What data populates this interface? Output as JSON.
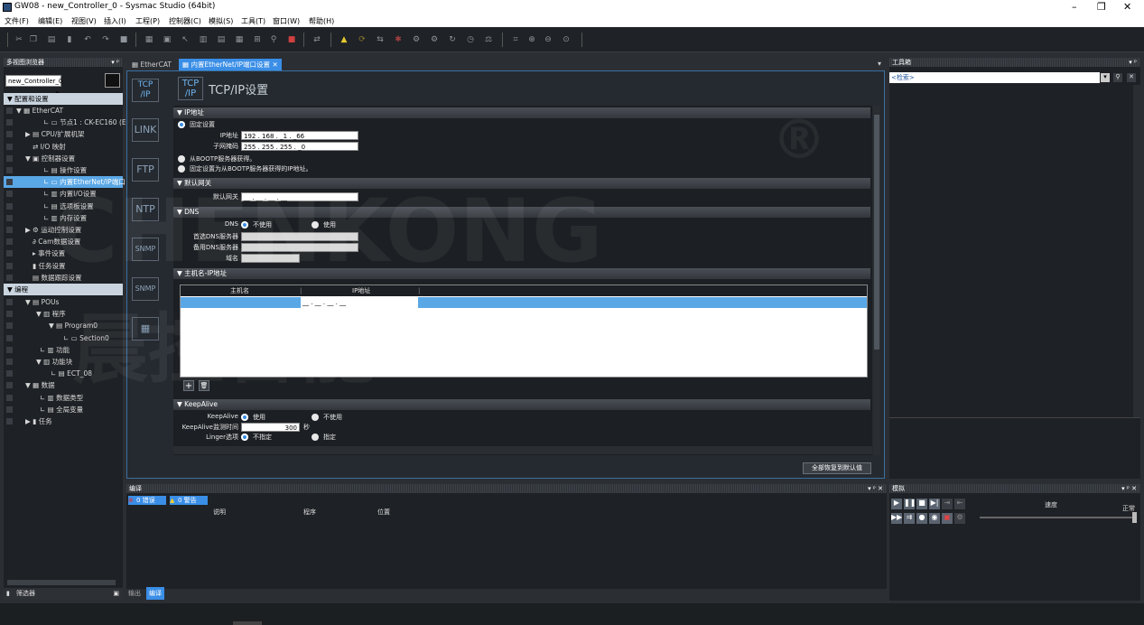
{
  "window": {
    "title": "GW08 - new_Controller_0 - Sysmac Studio (64bit)"
  },
  "menu": [
    "文件(F)",
    "编辑(E)",
    "视图(V)",
    "插入(I)",
    "工程(P)",
    "控制器(C)",
    "模拟(S)",
    "工具(T)",
    "窗口(W)",
    "帮助(H)"
  ],
  "left_panel": {
    "title": "多视图浏览器",
    "controller_select": "new_Controller_0",
    "section_config": "配置和设置",
    "tree_config": [
      "EtherCAT",
      "节点1 : CK-EC160 (E",
      "CPU/扩展机架",
      "I/O 映射",
      "控制器设置",
      "操作设置",
      "内置EtherNet/IP端口",
      "内置I/O设置",
      "选项板设置",
      "内存设置",
      "运动控制设置",
      "Cam数据设置",
      "事件设置",
      "任务设置",
      "数据跟踪设置"
    ],
    "section_program": "编程",
    "tree_program": [
      "POUs",
      "程序",
      "Program0",
      "Section0",
      "功能",
      "功能块",
      "ECT_08",
      "数据",
      "数据类型",
      "全局变量",
      "任务"
    ],
    "filter_label": "筛选器"
  },
  "tabs": [
    {
      "label": "EtherCAT"
    },
    {
      "label": "内置EtherNet/IP端口设置"
    }
  ],
  "editor": {
    "title": "TCP/IP设置",
    "side_icons": [
      "TCP/IP",
      "LINK",
      "FTP",
      "NTP",
      "SNMP",
      "SNMP",
      ""
    ],
    "sec_ip": "IP地址",
    "fixed_setting": "固定设置",
    "ip_label": "IP地址",
    "ip_value": "192 . 168 . _1 . _66",
    "mask_label": "子网掩码",
    "mask_value": "255 . 255 . 255 . _0",
    "bootp_opt": "从BOOTP服务器获得。",
    "bootp_fixed_opt": "固定设置为从BOOTP服务器获得的IP地址。",
    "sec_gateway": "默认网关",
    "gateway_label": "默认网关",
    "gateway_value": "__ . __ . __ . __",
    "sec_dns": "DNS",
    "dns_label": "DNS",
    "dns_off": "不使用",
    "dns_on": "使用",
    "primary_dns": "首选DNS服务器",
    "secondary_dns": "备用DNS服务器",
    "domain": "域名",
    "sec_host": "主机名-IP地址",
    "host_col_name": "主机名",
    "host_col_ip": "IP地址",
    "host_row_ip": "__ . __ . __ . __",
    "sec_keepalive": "KeepAlive",
    "keepalive_label": "KeepAlive",
    "keepalive_use": "使用",
    "keepalive_nouse": "不使用",
    "keepalive_time_label": "KeepAlive监测时间",
    "keepalive_time_value": "300",
    "keepalive_unit": "秒",
    "linger_label": "Linger选项",
    "linger_unspec": "不指定",
    "linger_spec": "指定",
    "restore_button": "全部恢复到默认值"
  },
  "bottom_panel": {
    "title": "编译",
    "errors": "0 错误",
    "warnings": "0 警告",
    "cols": [
      "说明",
      "程序",
      "位置"
    ],
    "tabs": [
      "输出",
      "编译"
    ]
  },
  "right_panel": {
    "title": "工具箱",
    "search": "<检索>"
  },
  "sim_panel": {
    "title": "模拟",
    "speed_label": "速度",
    "speed_value": "正常"
  },
  "watermark": {
    "text1": "CHENKONG",
    "text2": "晨控智能",
    "reg": "®"
  }
}
